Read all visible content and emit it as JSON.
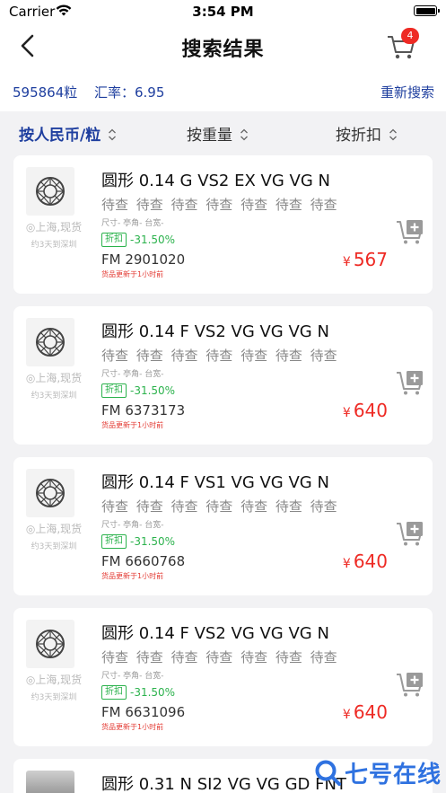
{
  "status": {
    "carrier": "Carrier",
    "time": "3:54 PM"
  },
  "nav": {
    "title": "搜索结果",
    "cart_badge": "4"
  },
  "info": {
    "count": "595864粒",
    "rate": "汇率：6.95",
    "research": "重新搜索"
  },
  "sort": {
    "by_price": "按人民币/粒",
    "by_weight": "按重量",
    "by_discount": "按折扣"
  },
  "items": [
    {
      "name": "圆形 0.14 G VS2 EX VG VG N",
      "pending": "待查 待查 待查 待查 待查 待查 待查",
      "location": "上海,现货",
      "shipping": "约3天到深圳",
      "size": "尺寸- 亭角- 台宽-",
      "discount_tag": "折扣",
      "discount": "-31.50%",
      "cert": "FM 2901020",
      "updated": "货品更新于1小时前",
      "currency": "¥",
      "price": "567"
    },
    {
      "name": "圆形 0.14 F VS2 VG VG VG N",
      "pending": "待查 待查 待查 待查 待查 待查 待查",
      "location": "上海,现货",
      "shipping": "约3天到深圳",
      "size": "尺寸- 亭角- 台宽-",
      "discount_tag": "折扣",
      "discount": "-31.50%",
      "cert": "FM 6373173",
      "updated": "货品更新于1小时前",
      "currency": "¥",
      "price": "640"
    },
    {
      "name": "圆形 0.14 F VS1 VG VG VG N",
      "pending": "待查 待查 待查 待查 待查 待查 待查",
      "location": "上海,现货",
      "shipping": "约3天到深圳",
      "size": "尺寸- 亭角- 台宽-",
      "discount_tag": "折扣",
      "discount": "-31.50%",
      "cert": "FM 6660768",
      "updated": "货品更新于1小时前",
      "currency": "¥",
      "price": "640"
    },
    {
      "name": "圆形 0.14 F VS2 VG VG VG N",
      "pending": "待查 待查 待查 待查 待查 待查 待查",
      "location": "上海,现货",
      "shipping": "约3天到深圳",
      "size": "尺寸- 亭角- 台宽-",
      "discount_tag": "折扣",
      "discount": "-31.50%",
      "cert": "FM 6631096",
      "updated": "货品更新于1小时前",
      "currency": "¥",
      "price": "640"
    },
    {
      "name": "圆形 0.31 N SI2 VG VG GD FNT"
    }
  ],
  "watermark": "七号在线",
  "colors": {
    "accent": "#1f3f9f",
    "price": "#ee2a24",
    "discount": "#2bb24c",
    "badge": "#ee2a24"
  }
}
